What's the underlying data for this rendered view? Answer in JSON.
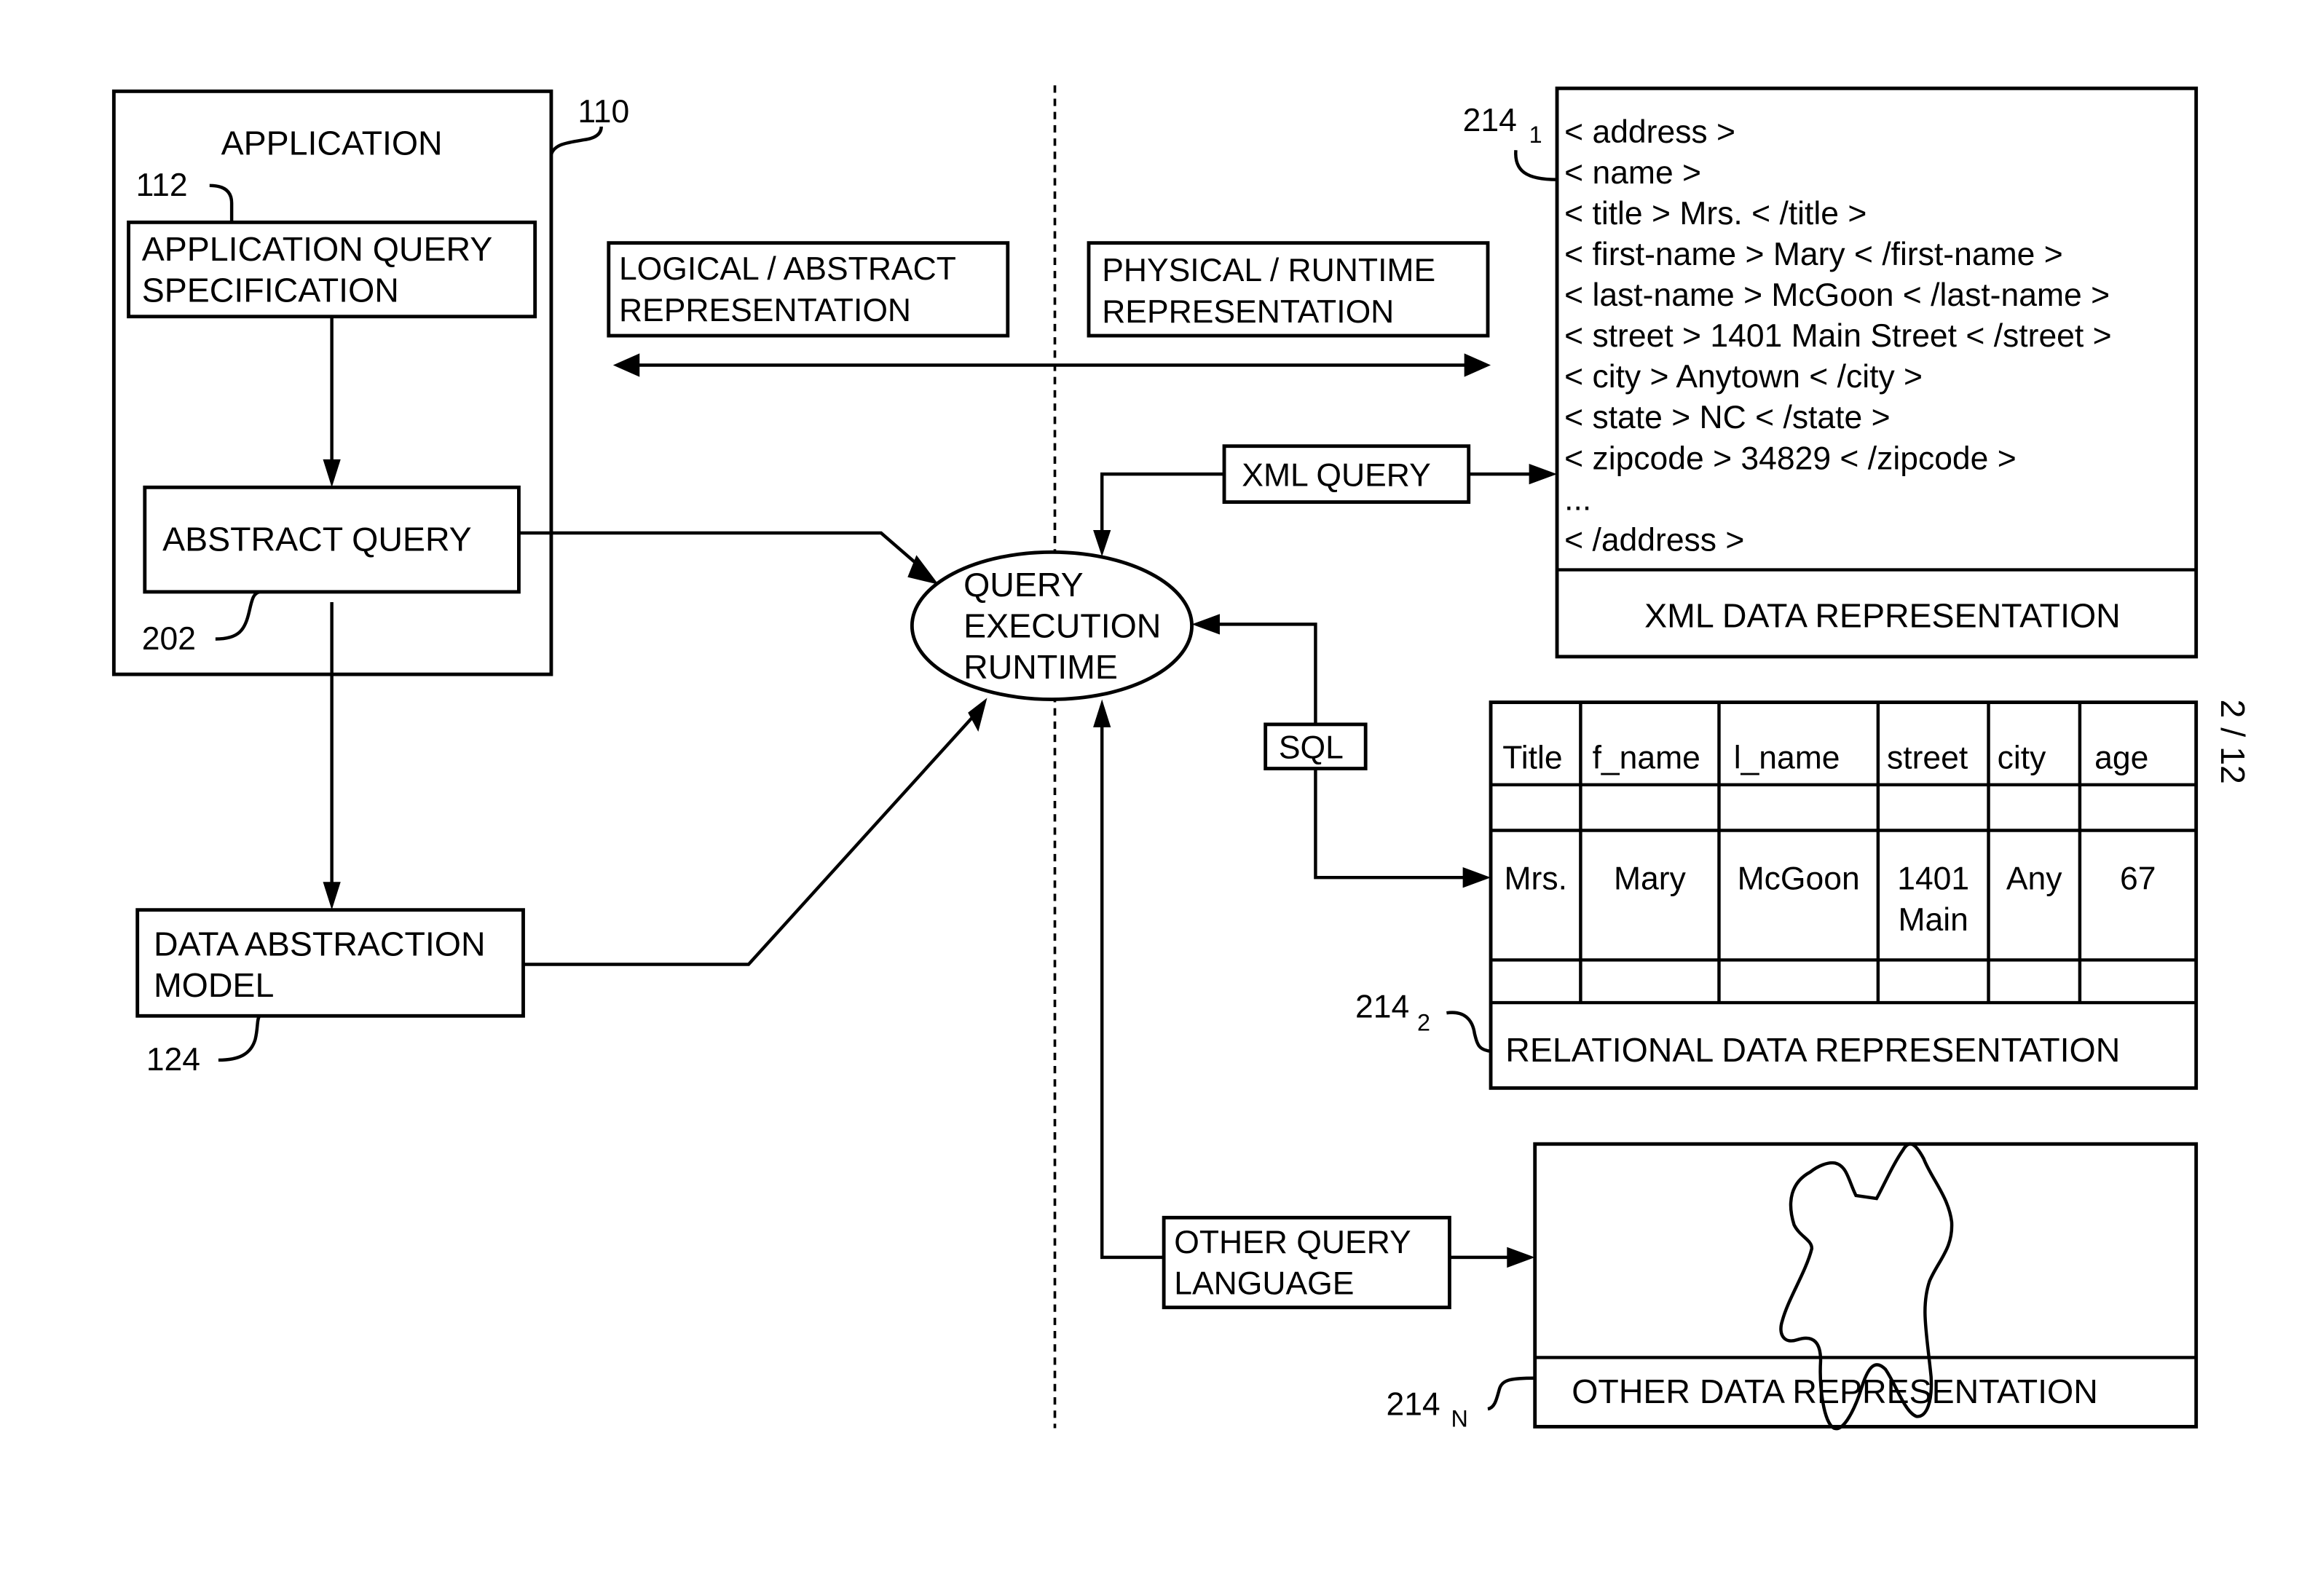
{
  "sheet": {
    "page_label": "2 / 12"
  },
  "application": {
    "title": "APPLICATION",
    "ref": "110",
    "query_spec": {
      "ref": "112",
      "lines": [
        "APPLICATION QUERY",
        "SPECIFICATION"
      ]
    },
    "abstract_query": {
      "ref": "202",
      "label": "ABSTRACT QUERY"
    }
  },
  "data_abstraction_model": {
    "ref": "124",
    "lines": [
      "DATA ABSTRACTION",
      "MODEL"
    ]
  },
  "representation_labels": {
    "logical": [
      "LOGICAL / ABSTRACT",
      "REPRESENTATION"
    ],
    "physical": [
      "PHYSICAL / RUNTIME",
      "REPRESENTATION"
    ]
  },
  "runtime": {
    "lines": [
      "QUERY",
      "EXECUTION",
      "RUNTIME"
    ]
  },
  "queries": {
    "xml": "XML QUERY",
    "sql": "SQL",
    "other": [
      "OTHER QUERY",
      "LANGUAGE"
    ]
  },
  "xml_rep": {
    "ref": "214",
    "ref_sub": "1",
    "lines": [
      "< address >",
      "< name >",
      "< title > Mrs. < /title >",
      "< first-name > Mary < /first-name >",
      "< last-name > McGoon < /last-name >",
      "< street > 1401 Main Street < /street >",
      "< city >  Anytown < /city >",
      "< state > NC < /state >",
      "< zipcode > 34829 < /zipcode >",
      "...",
      "< /address >"
    ],
    "caption": "XML DATA REPRESENTATION"
  },
  "relational_rep": {
    "ref": "214",
    "ref_sub": "2",
    "headers": [
      "Title",
      "f_name",
      "l_name",
      "street",
      "city",
      "age"
    ],
    "row": [
      [
        "Mrs."
      ],
      [
        "Mary"
      ],
      [
        "McGoon"
      ],
      [
        "1401",
        "Main"
      ],
      [
        "Any"
      ],
      [
        "67"
      ]
    ],
    "caption": "RELATIONAL DATA REPRESENTATION"
  },
  "other_rep": {
    "ref": "214",
    "ref_sub": "N",
    "caption": "OTHER DATA REPRESENTATION"
  }
}
